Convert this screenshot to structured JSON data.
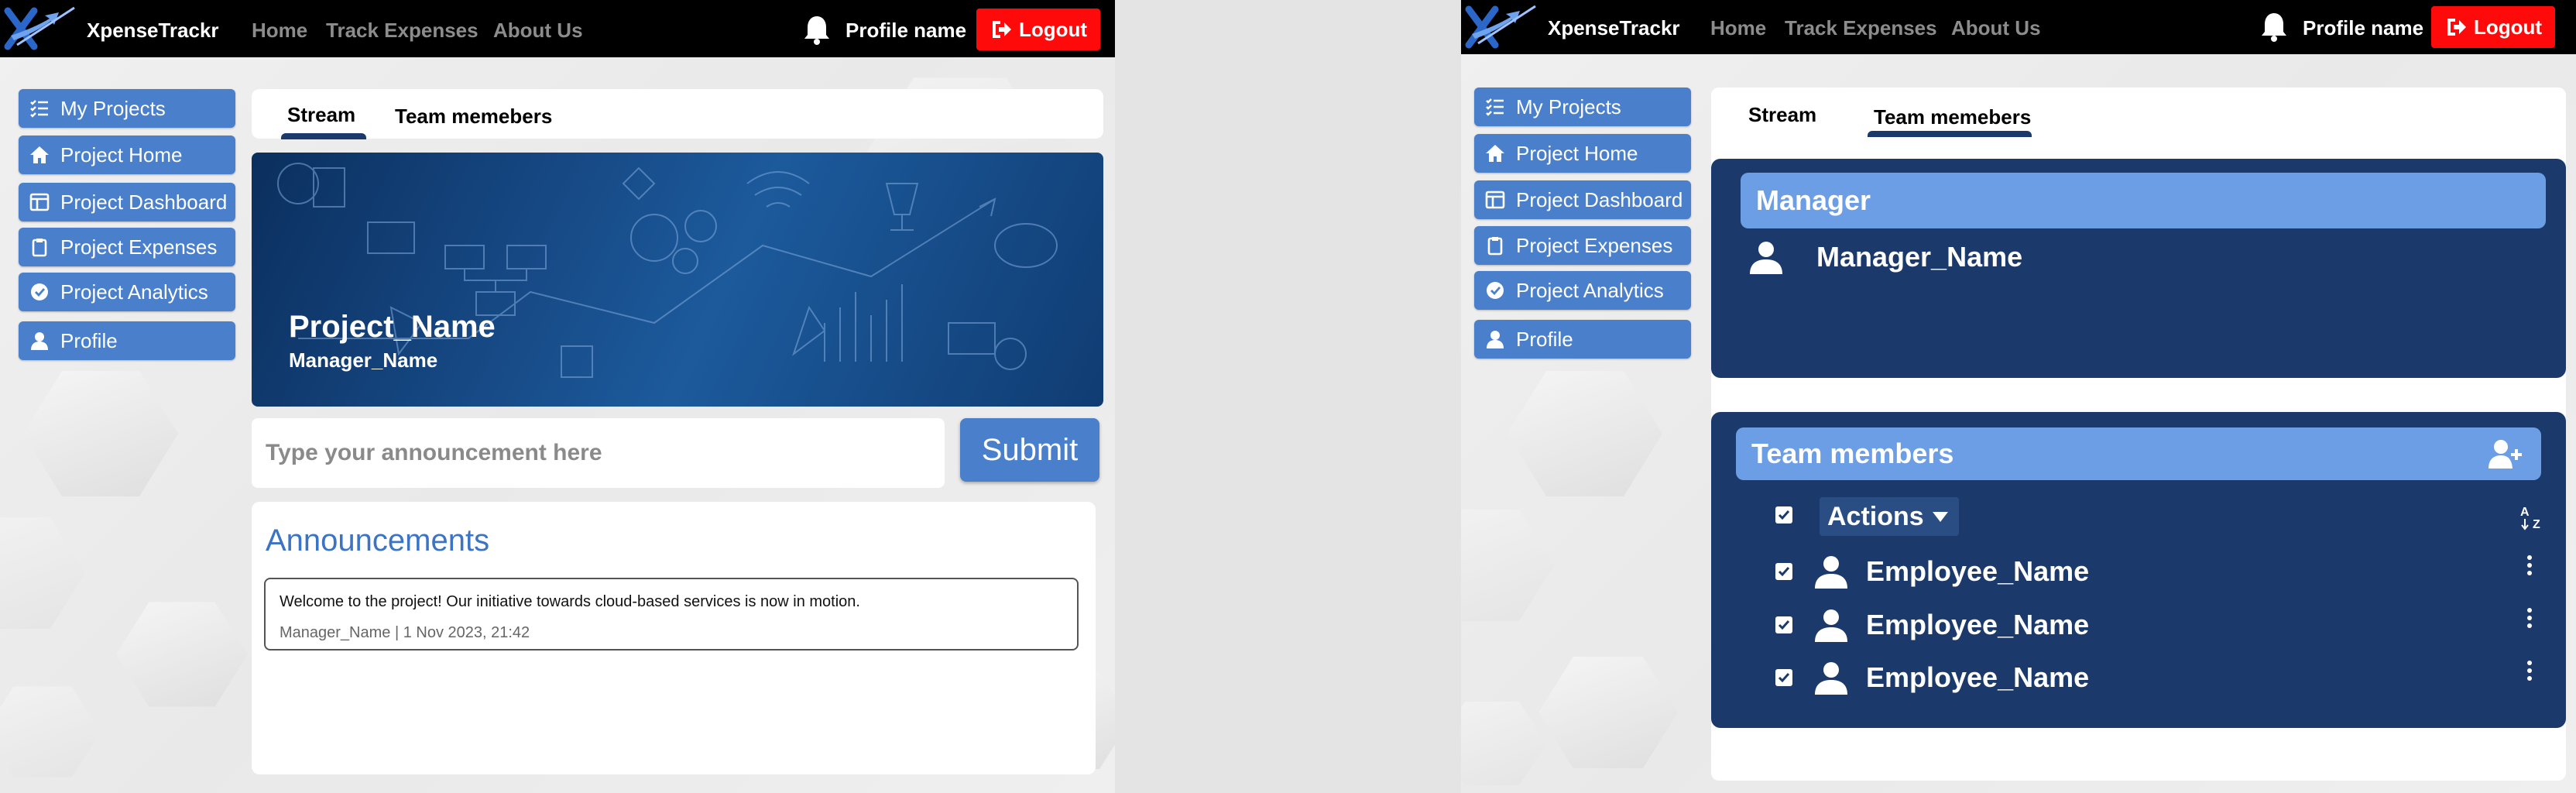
{
  "navbar": {
    "brand": "XpenseTrackr",
    "links": {
      "home": "Home",
      "track": "Track Expenses",
      "about": "About Us"
    },
    "profile_name": "Profile name",
    "logout_label": "Logout"
  },
  "sidebar": {
    "items": [
      {
        "label": "My Projects",
        "icon": "checklist-icon"
      },
      {
        "label": "Project Home",
        "icon": "home-icon"
      },
      {
        "label": "Project Dashboard",
        "icon": "dashboard-icon"
      },
      {
        "label": "Project Expenses",
        "icon": "clipboard-icon"
      },
      {
        "label": "Project Analytics",
        "icon": "check-circle-icon"
      },
      {
        "label": "Profile",
        "icon": "user-icon"
      }
    ]
  },
  "tabs": {
    "stream": "Stream",
    "members": "Team memebers"
  },
  "stream": {
    "project_name": "Project_Name",
    "manager_name": "Manager_Name",
    "input_placeholder": "Type your announcement here",
    "submit_label": "Submit",
    "announcements_heading": "Announcements",
    "announcement": {
      "text": "Welcome to the project! Our initiative towards cloud-based services is now in motion.",
      "meta": "Manager_Name | 1 Nov 2023, 21:42"
    }
  },
  "members": {
    "manager_heading": "Manager",
    "manager_name": "Manager_Name",
    "team_heading": "Team members",
    "actions_label": "Actions",
    "employees": [
      "Employee_Name",
      "Employee_Name",
      "Employee_Name"
    ]
  },
  "colors": {
    "navbar": "#000000",
    "sidebar_button": "#4a7fcc",
    "logout": "#ff0a0a",
    "panel_dark": "#1b3a6b",
    "panel_header": "#6c9ee6",
    "heading_blue": "#3b74c4"
  }
}
